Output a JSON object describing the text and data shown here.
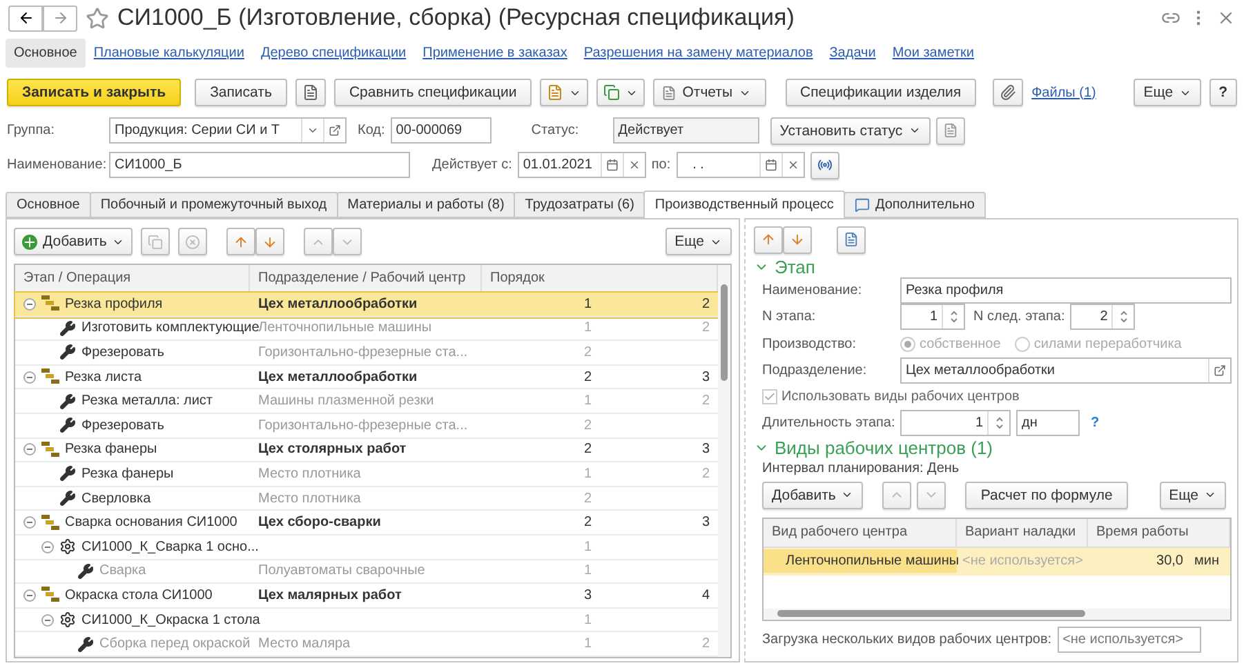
{
  "window": {
    "title": "СИ1000_Б (Изготовление, сборка) (Ресурсная спецификация)"
  },
  "nav": [
    {
      "label": "Основное",
      "selected": true
    },
    {
      "label": "Плановые калькуляции",
      "selected": false
    },
    {
      "label": "Дерево спецификации",
      "selected": false
    },
    {
      "label": "Применение в заказах",
      "selected": false
    },
    {
      "label": "Разрешения на замену материалов",
      "selected": false
    },
    {
      "label": "Задачи",
      "selected": false
    },
    {
      "label": "Мои заметки",
      "selected": false
    }
  ],
  "toolbar": {
    "save_close": "Записать и закрыть",
    "save": "Записать",
    "compare": "Сравнить спецификации",
    "reports": "Отчеты",
    "specs": "Спецификации изделия",
    "files": "Файлы (1)",
    "more": "Еще",
    "help": "?"
  },
  "header": {
    "group_label": "Группа:",
    "group_value": "Продукция: Серии СИ и Т",
    "code_label": "Код:",
    "code_value": "00-000069",
    "status_label": "Статус:",
    "status_value": "Действует",
    "set_status": "Установить статус",
    "name_label": "Наименование:",
    "name_value": "СИ1000_Б",
    "from_label": "Действует с:",
    "from_value": "01.01.2021",
    "to_label": "по:",
    "to_value": ". ."
  },
  "tabs": [
    {
      "label": "Основное",
      "selected": false
    },
    {
      "label": "Побочный и промежуточный выход",
      "selected": false
    },
    {
      "label": "Материалы и работы (8)",
      "selected": false
    },
    {
      "label": "Трудозатраты (6)",
      "selected": false
    },
    {
      "label": "Производственный процесс",
      "selected": true
    },
    {
      "label": "Дополнительно",
      "selected": false
    }
  ],
  "tree": {
    "add": "Добавить",
    "more": "Еще",
    "columns": [
      "Этап / Операция",
      "Подразделение / Рабочий центр",
      "Порядок"
    ],
    "rows": [
      {
        "kind": "stage",
        "name": "Резка профиля",
        "center": "Цех металлообработки",
        "order": "1",
        "next": "2",
        "selected": true,
        "expanded": true,
        "children": [
          {
            "kind": "operation",
            "name": "Изготовить комплектующие",
            "center": "Ленточнопильные машины",
            "order": "1",
            "next": "2",
            "selected": false
          },
          {
            "kind": "operation",
            "name": "Фрезеровать",
            "center": "Горизонтально-фрезерные ста...",
            "order": "2",
            "selected": false
          }
        ]
      },
      {
        "kind": "stage",
        "name": "Резка листа",
        "center": "Цех металлообработки",
        "order": "2",
        "next": "3",
        "selected": false,
        "expanded": true,
        "children": [
          {
            "kind": "operation",
            "name": "Резка металла: лист",
            "center": "Машины плазменной резки",
            "order": "1",
            "next": "2",
            "selected": false
          },
          {
            "kind": "operation",
            "name": "Фрезеровать",
            "center": "Горизонтально-фрезерные ста...",
            "order": "2",
            "selected": false
          }
        ]
      },
      {
        "kind": "stage",
        "name": "Резка фанеры",
        "center": "Цех столярных работ",
        "order": "2",
        "next": "3",
        "selected": false,
        "expanded": true,
        "children": [
          {
            "kind": "operation",
            "name": "Резка фанеры",
            "center": "Место плотника",
            "order": "1",
            "next": "2",
            "selected": false
          },
          {
            "kind": "operation",
            "name": "Сверловка",
            "center": "Место плотника",
            "order": "2",
            "selected": false
          }
        ]
      },
      {
        "kind": "stage",
        "name": "Сварка основания СИ1000",
        "center": "Цех сборо-сварки",
        "order": "2",
        "next": "3",
        "selected": false,
        "expanded": true,
        "children": [
          {
            "kind": "component",
            "name": "СИ1000_К_Сварка 1 осно...",
            "order": "1",
            "selected": false,
            "expanded": true,
            "children": [
              {
                "kind": "operation",
                "name": "Сварка",
                "center": "Полуавтоматы сварочные",
                "order": "1",
                "selected": false
              }
            ]
          }
        ]
      },
      {
        "kind": "stage",
        "name": "Окраска стола СИ1000",
        "center": "Цех малярных работ",
        "order": "3",
        "next": "4",
        "selected": false,
        "expanded": true,
        "children": [
          {
            "kind": "component",
            "name": "СИ1000_К_Окраска 1 стола",
            "order": "1",
            "selected": false,
            "expanded": true,
            "children": [
              {
                "kind": "operation",
                "name": "Сборка перед окраской",
                "center": "Место маляра",
                "order": "1",
                "next": "2",
                "selected": false
              }
            ]
          }
        ]
      }
    ]
  },
  "stage": {
    "title": "Этап",
    "expanded": true,
    "name_label": "Наименование:",
    "name_value": "Резка профиля",
    "num_label": "N этапа:",
    "num_value": "1",
    "next_label": "N след. этапа:",
    "next_value": "2",
    "production_label": "Производство:",
    "production_options": [
      {
        "label": "собственное",
        "selected": true
      },
      {
        "label": "силами переработчика",
        "selected": false
      }
    ],
    "division_label": "Подразделение:",
    "division_value": "Цех металлообработки",
    "use_centers": {
      "label": "Использовать виды рабочих центров",
      "checked": true
    },
    "duration_label": "Длительность этапа:",
    "duration_value": "1",
    "duration_unit": "дн",
    "help": "?"
  },
  "work_centers": {
    "title": "Виды рабочих центров (1)",
    "expanded": true,
    "interval": "Интервал планирования: День",
    "add": "Добавить",
    "formula": "Расчет по формуле",
    "more": "Еще",
    "columns": [
      "Вид рабочего центра",
      "Вариант наладки",
      "Время работы"
    ],
    "rows": [
      {
        "type": "Ленточнопильные машины",
        "setup": "<не используется>",
        "time": "30,0",
        "unit": "мин",
        "selected": true
      }
    ],
    "load_label": "Загрузка нескольких видов рабочих центров:",
    "load_placeholder": "<не используется>"
  }
}
